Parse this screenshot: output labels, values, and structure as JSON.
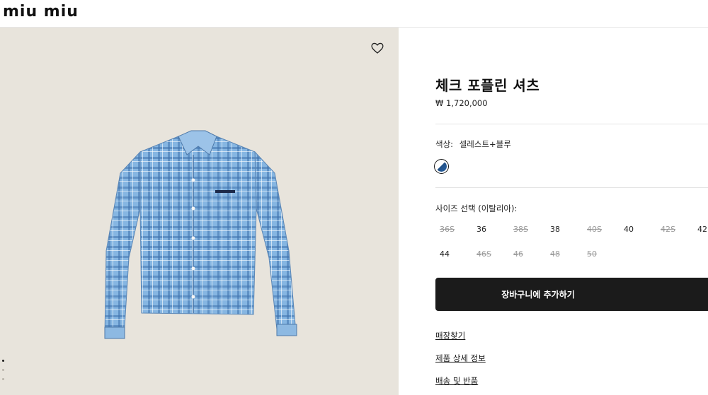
{
  "brand": {
    "logo_text": "miu miu"
  },
  "product": {
    "title": "체크 포플린 셔츠",
    "price": "₩ 1,720,000"
  },
  "color": {
    "label": "색상:",
    "value": "셀레스트+블루",
    "swatch_colors": [
      "#ffffff",
      "#2b62a3"
    ]
  },
  "sizes": {
    "label": "사이즈 선택 (이탈리아):",
    "options": [
      {
        "label": "36S",
        "available": false
      },
      {
        "label": "36",
        "available": true
      },
      {
        "label": "38S",
        "available": false
      },
      {
        "label": "38",
        "available": true
      },
      {
        "label": "40S",
        "available": false
      },
      {
        "label": "40",
        "available": true
      },
      {
        "label": "42S",
        "available": false
      },
      {
        "label": "42",
        "available": true
      },
      {
        "label": "44",
        "available": true
      },
      {
        "label": "46S",
        "available": false
      },
      {
        "label": "46",
        "available": false
      },
      {
        "label": "48",
        "available": false
      },
      {
        "label": "50",
        "available": false
      }
    ]
  },
  "actions": {
    "add_to_cart": "장바구니에 추가하기",
    "find_store": "매장찾기",
    "product_details": "제품 상세 정보",
    "shipping_returns": "배송 및 반품"
  },
  "gallery": {
    "dots": 3,
    "active_index": 0
  },
  "colors": {
    "background_image": "#e8e4dc",
    "button": "#1b1b1b",
    "shirt": "#7fb1de"
  },
  "icons": {
    "wishlist": "heart-icon"
  }
}
